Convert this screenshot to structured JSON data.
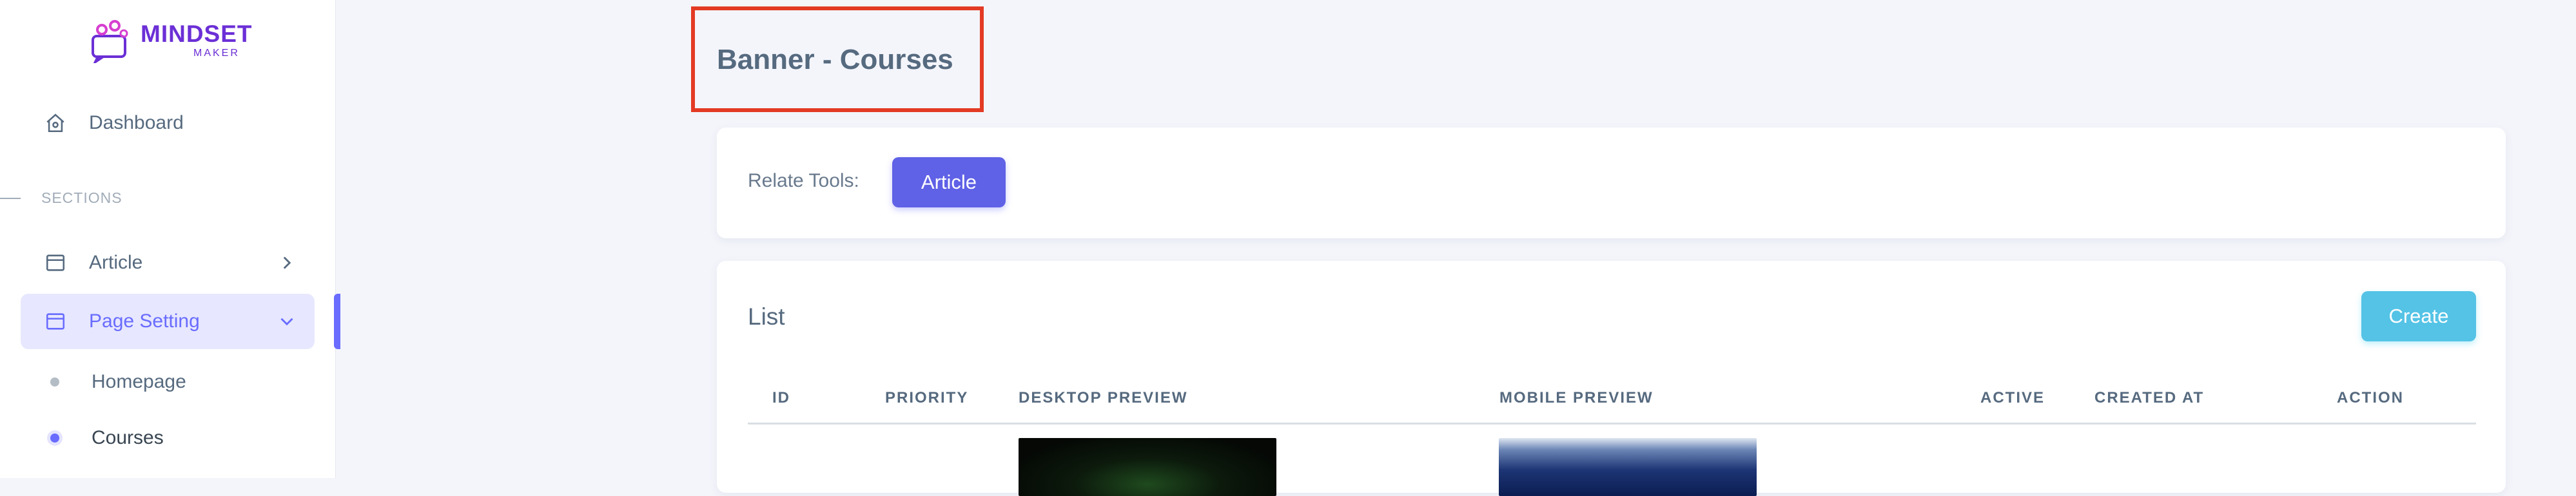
{
  "logo": {
    "title": "MINDSET",
    "subtitle": "MAKER"
  },
  "sidebar": {
    "dashboard": "Dashboard",
    "section_header": "SECTIONS",
    "article": "Article",
    "page_setting": "Page Setting",
    "sub_items": [
      "Homepage",
      "Courses"
    ]
  },
  "page": {
    "title": "Banner - Courses"
  },
  "tools": {
    "label": "Relate Tools:",
    "article_button": "Article"
  },
  "list": {
    "title": "List",
    "create_button": "Create",
    "columns": [
      "ID",
      "PRIORITY",
      "DESKTOP PREVIEW",
      "MOBILE PREVIEW",
      "ACTIVE",
      "CREATED AT",
      "ACTION"
    ]
  },
  "colors": {
    "accent": "#696cff",
    "info": "#54c3e6",
    "highlight": "#e33a24"
  }
}
